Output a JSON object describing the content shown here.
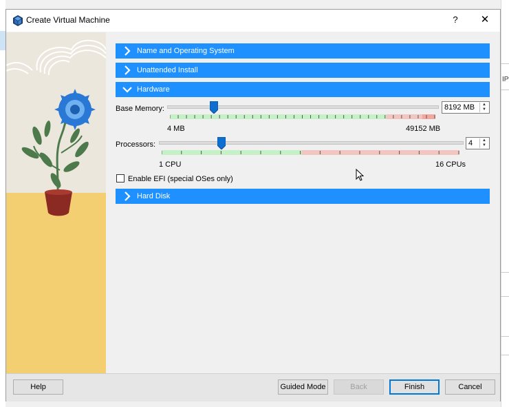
{
  "window": {
    "title": "Create Virtual Machine",
    "help_glyph": "?",
    "close_glyph": "✕",
    "background_right_text": "IPv"
  },
  "sections": {
    "name_os": "Name and Operating System",
    "unattended": "Unattended Install",
    "hardware": "Hardware",
    "hard_disk": "Hard Disk"
  },
  "hardware": {
    "memory": {
      "label": "Base Memory:",
      "value": "8192 MB",
      "min_label": "4 MB",
      "max_label": "49152 MB",
      "fraction": 0.167
    },
    "processors": {
      "label": "Processors:",
      "value": "4",
      "min_label": "1 CPU",
      "max_label": "16 CPUs",
      "fraction": 0.2
    },
    "efi_label": "Enable EFI (special OSes only)",
    "efi_checked": false
  },
  "buttons": {
    "help": "Help",
    "guided": "Guided Mode",
    "back": "Back",
    "finish": "Finish",
    "cancel": "Cancel"
  },
  "colors": {
    "section_blue": "#1e90ff",
    "slider_green": "#c6f0c6",
    "slider_red": "#f2c6c0",
    "handle_blue": "#0f6fd0"
  },
  "icons": {
    "title": "virtualbox-icon",
    "chevron_right": "chevron-right-icon",
    "chevron_down": "chevron-down-icon"
  }
}
